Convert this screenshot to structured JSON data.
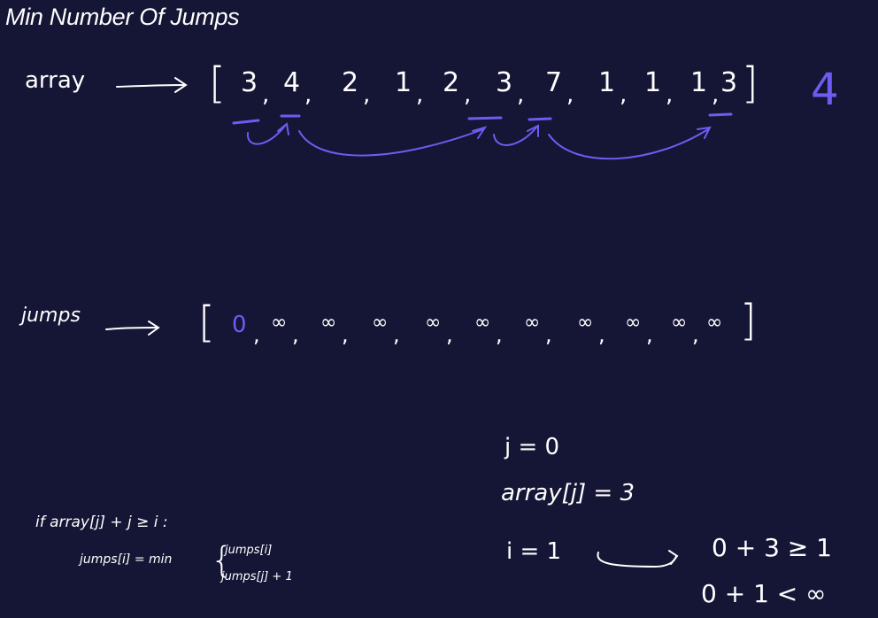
{
  "title": "Min Number Of Jumps",
  "array_row": {
    "label": "array",
    "open_bracket": "[",
    "close_bracket": "]",
    "values": [
      "3",
      "4",
      "2",
      "1",
      "2",
      "3",
      "7",
      "1",
      "1",
      "1",
      "3"
    ],
    "answer": "4"
  },
  "jumps_row": {
    "label": "jumps",
    "open_bracket": "[",
    "close_bracket": "]",
    "values": [
      "0",
      "∞",
      "∞",
      "∞",
      "∞",
      "∞",
      "∞",
      "∞",
      "∞",
      "∞",
      "∞"
    ]
  },
  "condition": {
    "if_line": "if   array[j] + j ≥ i :",
    "assign_left": "jumps[i] = min",
    "option_1": "jumps[i]",
    "option_2": "jumps[j] + 1"
  },
  "work": {
    "j_line": "j = 0",
    "array_j_line": "array[j] = 3",
    "i_line": "i = 1",
    "check_1": "0 + 3 ≥ 1",
    "check_2": "0 + 1 < ∞"
  },
  "colors": {
    "background": "#151535",
    "ink": "#ffffff",
    "accent": "#6e5cf0"
  }
}
